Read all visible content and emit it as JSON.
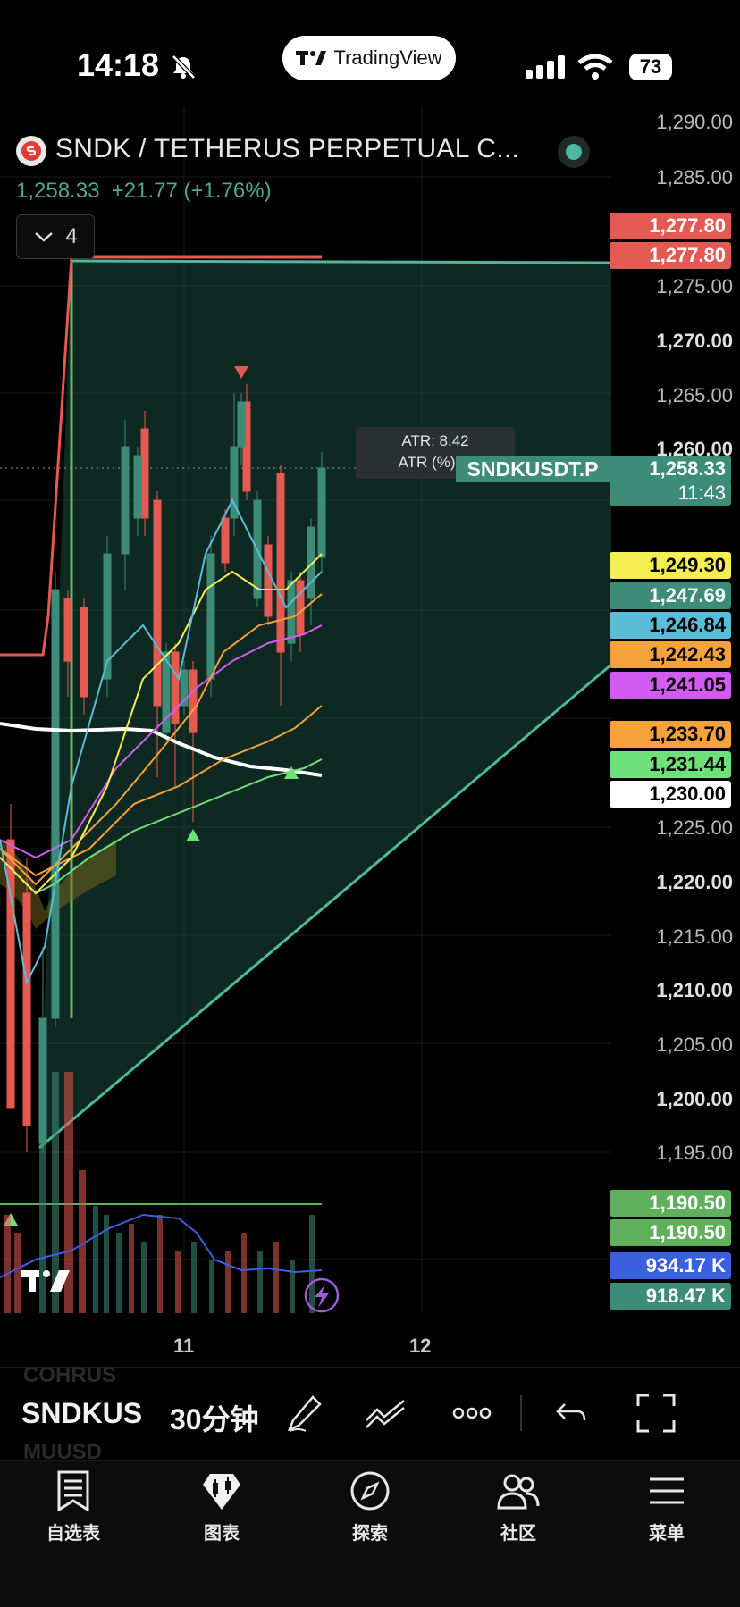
{
  "status_bar": {
    "time": "14:18",
    "app_name": "TradingView",
    "battery": "73"
  },
  "header": {
    "symbol_title": "SNDK / TETHERUS PERPETUAL C...",
    "last_price": "1,258.33",
    "change": "+21.77 (+1.76%)",
    "indicator_count": "4"
  },
  "price_scale": {
    "ticks": [
      "1,290.00",
      "1,285.00",
      "1,275.00",
      "1,270.00",
      "1,265.00",
      "1,260.00",
      "1,225.00",
      "1,220.00",
      "1,215.00",
      "1,210.00",
      "1,205.00",
      "1,200.00",
      "1,195.00"
    ],
    "labels": [
      {
        "text": "1,277.80",
        "bg": "#e45a52",
        "fg": "#ffffff"
      },
      {
        "text": "1,277.80",
        "bg": "#e45a52",
        "fg": "#ffffff"
      },
      {
        "text": "1,249.30",
        "bg": "#f4ee52",
        "fg": "#000000"
      },
      {
        "text": "1,247.69",
        "bg": "#3d8c78",
        "fg": "#ffffff"
      },
      {
        "text": "1,246.84",
        "bg": "#5bbcd8",
        "fg": "#000000"
      },
      {
        "text": "1,242.43",
        "bg": "#f5a23a",
        "fg": "#000000"
      },
      {
        "text": "1,241.05",
        "bg": "#d35cf0",
        "fg": "#000000"
      },
      {
        "text": "1,233.70",
        "bg": "#f5a23a",
        "fg": "#000000"
      },
      {
        "text": "1,231.44",
        "bg": "#6fe07a",
        "fg": "#000000"
      },
      {
        "text": "1,230.00",
        "bg": "#ffffff",
        "fg": "#000000"
      },
      {
        "text": "1,190.50",
        "bg": "#5fb05a",
        "fg": "#ffffff"
      },
      {
        "text": "1,190.50",
        "bg": "#5fb05a",
        "fg": "#ffffff"
      },
      {
        "text": "934.17 K",
        "bg": "#3a5fe0",
        "fg": "#ffffff"
      },
      {
        "text": "918.47 K",
        "bg": "#3d8c78",
        "fg": "#ffffff"
      }
    ],
    "current_price": "1,258.33",
    "countdown": "11:43"
  },
  "chart_overlay": {
    "atr_label": "ATR: 8.42",
    "atr_pct_label": "ATR (%): 0",
    "symbol_tag": "SNDKUSDT.P"
  },
  "time_axis": {
    "ticks": [
      "11",
      "12"
    ]
  },
  "toolbar": {
    "symbol": "SNDKUS",
    "interval": "30分钟",
    "ghost_top": "COHRUS",
    "ghost_bottom": "MUUSD"
  },
  "bottom_nav": [
    {
      "label": "自选表",
      "icon": "watchlist-icon"
    },
    {
      "label": "图表",
      "icon": "chart-icon"
    },
    {
      "label": "探索",
      "icon": "compass-icon"
    },
    {
      "label": "社区",
      "icon": "community-icon"
    },
    {
      "label": "菜单",
      "icon": "menu-icon"
    }
  ],
  "colors": {
    "accent_green": "#3d8c78",
    "down_red": "#e45a52",
    "background": "#000000"
  }
}
